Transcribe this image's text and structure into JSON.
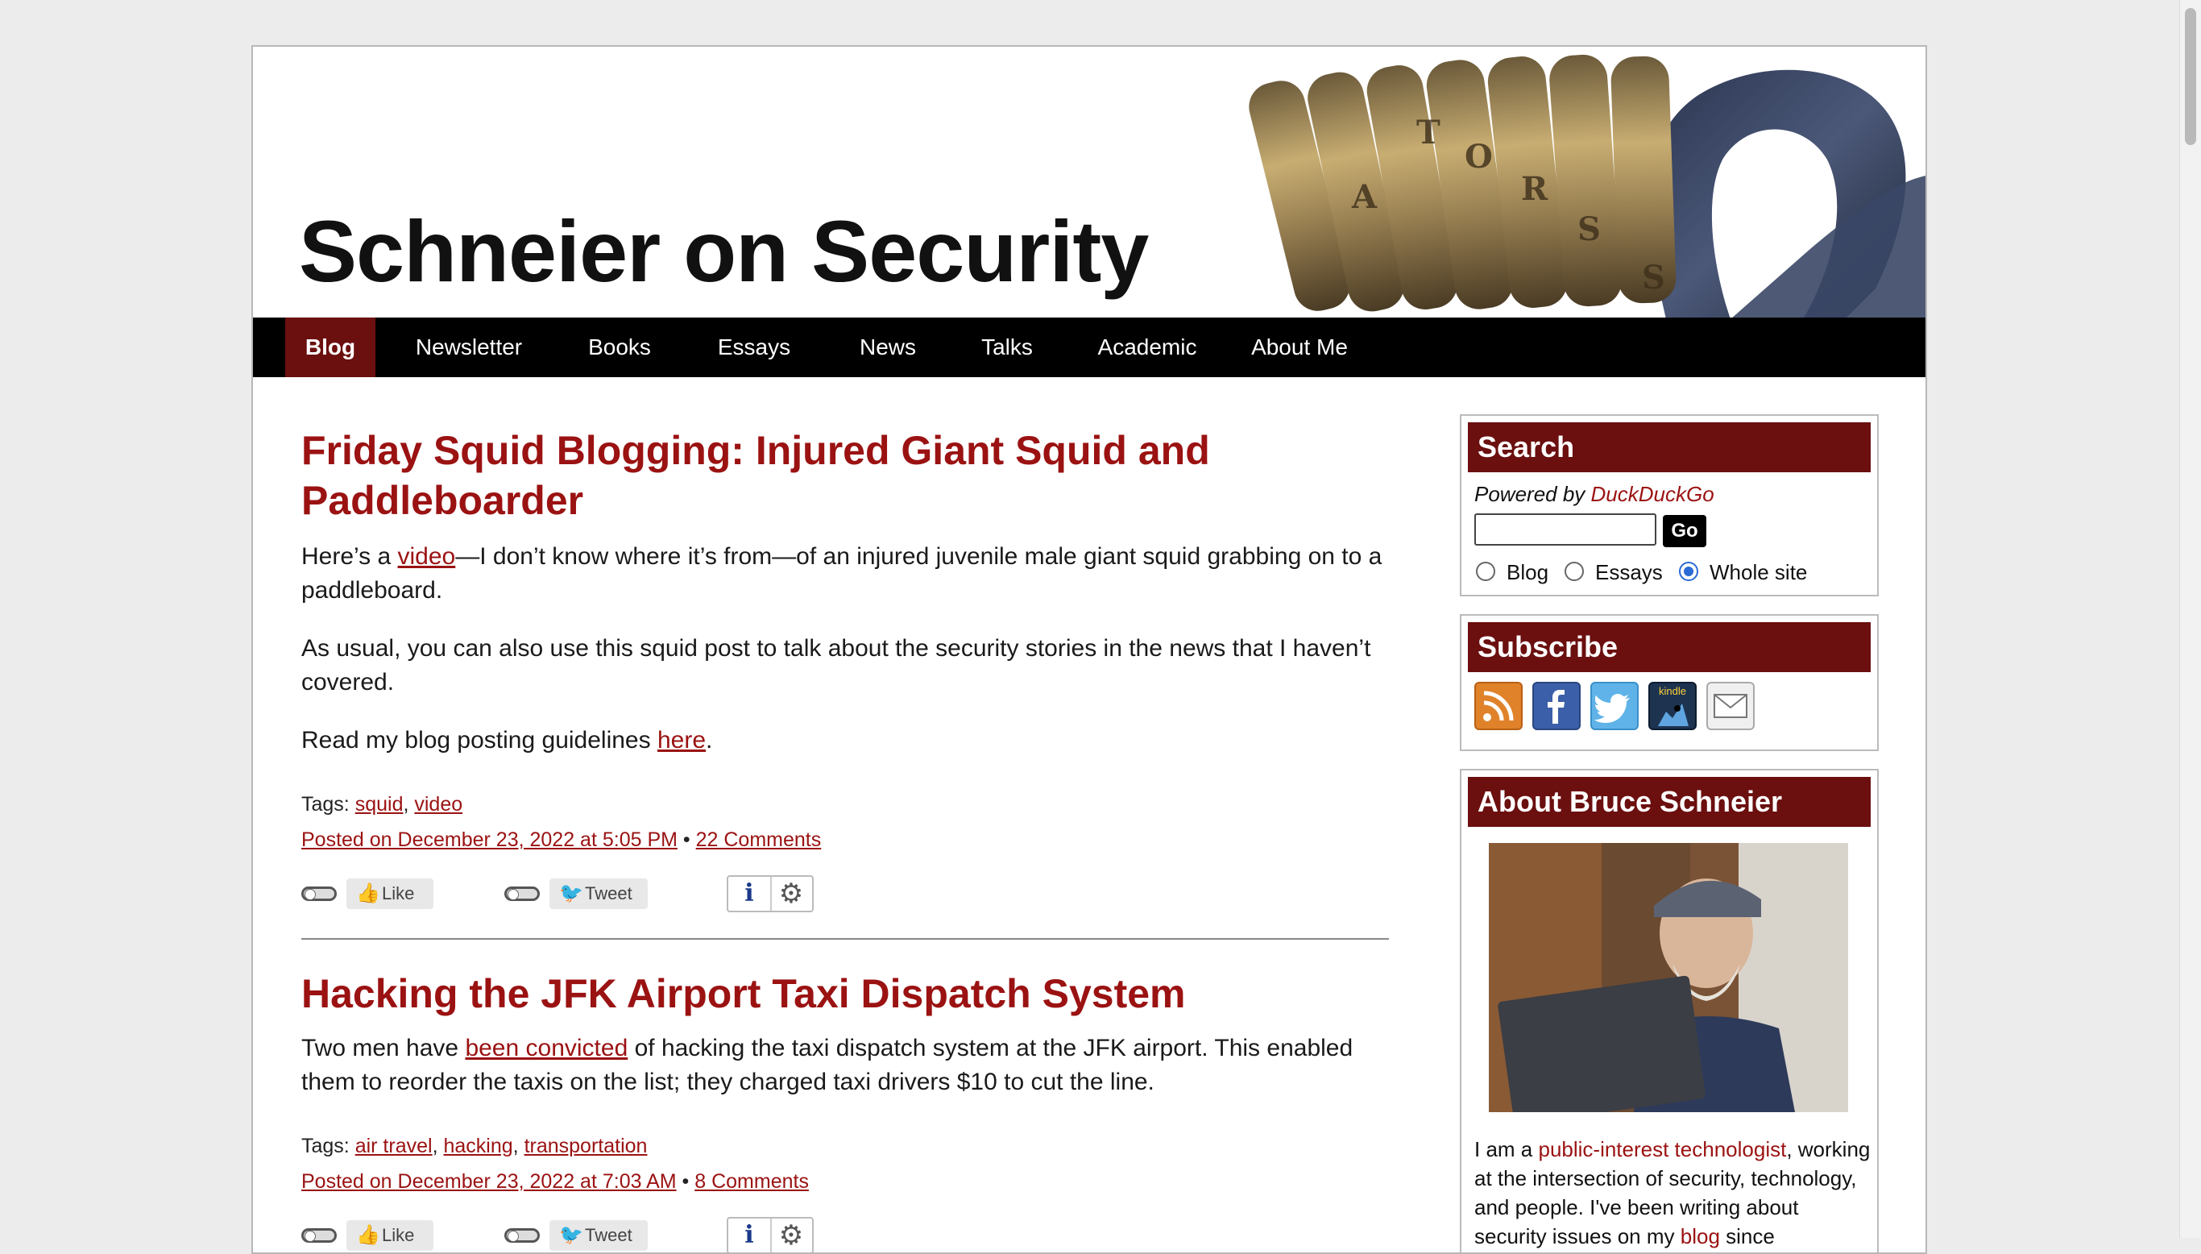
{
  "site": {
    "title": "Schneier on Security"
  },
  "nav": {
    "items": [
      {
        "label": "Blog",
        "active": true
      },
      {
        "label": "Newsletter"
      },
      {
        "label": "Books"
      },
      {
        "label": "Essays"
      },
      {
        "label": "News"
      },
      {
        "label": "Talks"
      },
      {
        "label": "Academic"
      },
      {
        "label": "About Me"
      }
    ]
  },
  "posts": [
    {
      "title": "Friday Squid Blogging: Injured Giant Squid and Paddleboarder",
      "p1_before": "Here’s a ",
      "p1_link": "video",
      "p1_after": "—I don’t know where it’s from—of an injured juvenile male giant squid grabbing on to a paddleboard.",
      "p2": "As usual, you can also use this squid post to talk about the security stories in the news that I haven’t covered.",
      "p3_before": "Read my blog posting guidelines ",
      "p3_link": "here",
      "p3_after": ".",
      "tags_label": "Tags: ",
      "tags": [
        "squid",
        "video"
      ],
      "posted": "Posted on December 23, 2022 at 5:05 PM",
      "comments": "22 Comments"
    },
    {
      "title": "Hacking the JFK Airport Taxi Dispatch System",
      "p1_before": "Two men have ",
      "p1_link": "been convicted",
      "p1_after": " of hacking the taxi dispatch system at the JFK airport. This enabled them to reorder the taxis on the list; they charged taxi drivers $10 to cut the line.",
      "tags_label": "Tags: ",
      "tags": [
        "air travel",
        "hacking",
        "transportation"
      ],
      "posted": "Posted on December 23, 2022 at 7:03 AM",
      "comments": "8 Comments"
    }
  ],
  "social": {
    "like": "Like",
    "tweet": "Tweet",
    "info": "i",
    "gear": "⚙"
  },
  "sidebar": {
    "search": {
      "title": "Search",
      "powered_prefix": "Powered by ",
      "powered_link": "DuckDuckGo",
      "go": "Go",
      "options": [
        "Blog",
        "Essays",
        "Whole site"
      ],
      "selected": "Whole site"
    },
    "subscribe": {
      "title": "Subscribe",
      "icons": [
        "rss-icon",
        "facebook-icon",
        "twitter-icon",
        "kindle-icon",
        "email-icon"
      ],
      "kindle_text": "kindle"
    },
    "about": {
      "title": "About Bruce Schneier",
      "text_before": "I am a ",
      "text_link": "public-interest technologist",
      "text_after": ", working at the intersection of security, technology, and people. I've been writing about security issues on my ",
      "text_link2": "blog",
      "text_tail": " since"
    }
  },
  "colors": {
    "accent": "#9b1212",
    "nav_active": "#6b0f0f",
    "nav_bg": "#000000"
  }
}
